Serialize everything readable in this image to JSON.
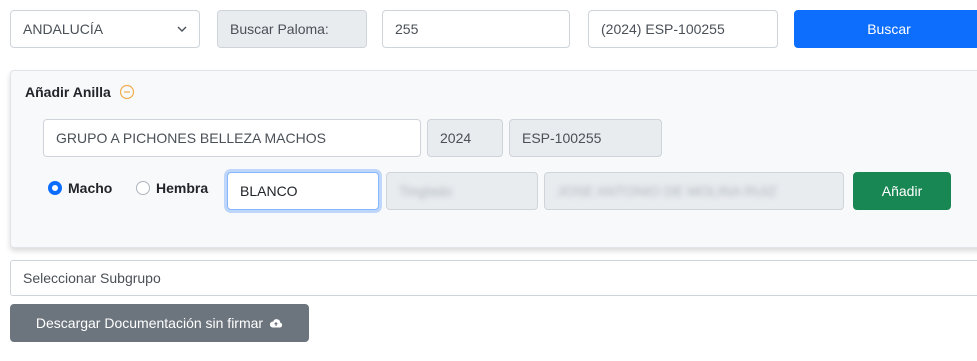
{
  "search": {
    "region": "ANDALUCÍA",
    "search_label": "Buscar Paloma:",
    "ring_number": "255",
    "ring_full": "(2024) ESP-100255",
    "search_button": "Buscar"
  },
  "add_ring": {
    "title": "Añadir Anilla",
    "group": "GRUPO A PICHONES BELLEZA MACHOS",
    "year": "2024",
    "code": "ESP-100255",
    "sex_options": [
      {
        "label": "Macho",
        "checked": true
      },
      {
        "label": "Hembra",
        "checked": false
      }
    ],
    "color": "BLANCO",
    "blurred_field_1": "Tinglado",
    "blurred_field_2": "JOSE ANTONIO DE MOLINA RUIZ",
    "add_button": "Añadir"
  },
  "subgroup": {
    "placeholder": "Seleccionar Subgrupo"
  },
  "download": {
    "label": "Descargar Documentación sin firmar",
    "icon": "cloud-upload-icon"
  },
  "colors": {
    "primary": "#0d6efd",
    "success": "#198754",
    "secondary": "#6c757d",
    "warning_icon": "#f0ad4e"
  }
}
